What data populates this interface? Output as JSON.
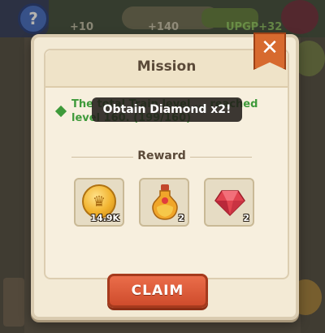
{
  "hud": {
    "help_icon": "question-icon",
    "values": [
      "+10",
      "+140",
      "UPGP+32"
    ]
  },
  "dialog": {
    "title": "Mission",
    "close_icon": "close-icon",
    "task_text": "The total Train level ... reached level 160. (199/160)",
    "toast": "Obtain Diamond x2!",
    "reward_label": "Reward",
    "rewards": [
      {
        "icon": "gold-coin-icon",
        "qty": "14.9K"
      },
      {
        "icon": "potion-icon",
        "qty": "2"
      },
      {
        "icon": "ruby-icon",
        "qty": "2"
      }
    ],
    "claim_label": "CLAIM"
  },
  "colors": {
    "accent_orange": "#d76a2f",
    "claim_red": "#d9563a",
    "task_green": "#3e9a3a",
    "panel_bg": "#f3ead5"
  }
}
